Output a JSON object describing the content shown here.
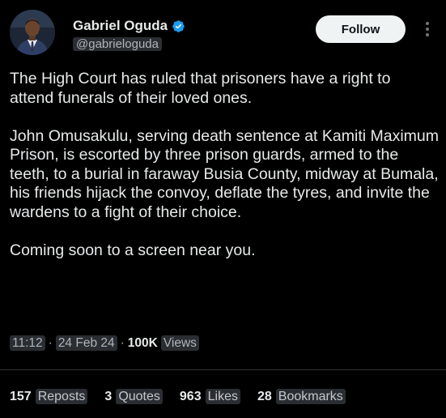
{
  "author": {
    "display_name": "Gabriel Oguda",
    "handle": "@gabrieloguda",
    "verified": true,
    "verified_color": "#1d9bf0"
  },
  "actions": {
    "follow_label": "Follow",
    "more_icon": "more-vertical-icon"
  },
  "post": {
    "paragraphs": [
      "The High Court has ruled that prisoners have a right to attend funerals of their loved ones.",
      "John Omusakulu, serving death sentence at Kamiti Maximum Prison, is escorted by three prison guards, armed to the teeth, to a burial in faraway Busia County, midway at Bumala, his friends hijack the convoy, deflate the tyres, and invite the wardens to a fight of their choice.",
      "Coming soon to a screen near you."
    ],
    "time": "11:12",
    "date": "24 Feb 24",
    "separator": "·",
    "views_count": "100K",
    "views_label": "Views"
  },
  "stats": [
    {
      "count": "157",
      "label": "Reposts"
    },
    {
      "count": "3",
      "label": "Quotes"
    },
    {
      "count": "963",
      "label": "Likes"
    },
    {
      "count": "28",
      "label": "Bookmarks"
    }
  ],
  "colors": {
    "background": "#000000",
    "text": "#e7e9ea",
    "secondary_text": "#b0b5ba",
    "follow_bg": "#eff3f4",
    "divider": "#2f3336"
  }
}
